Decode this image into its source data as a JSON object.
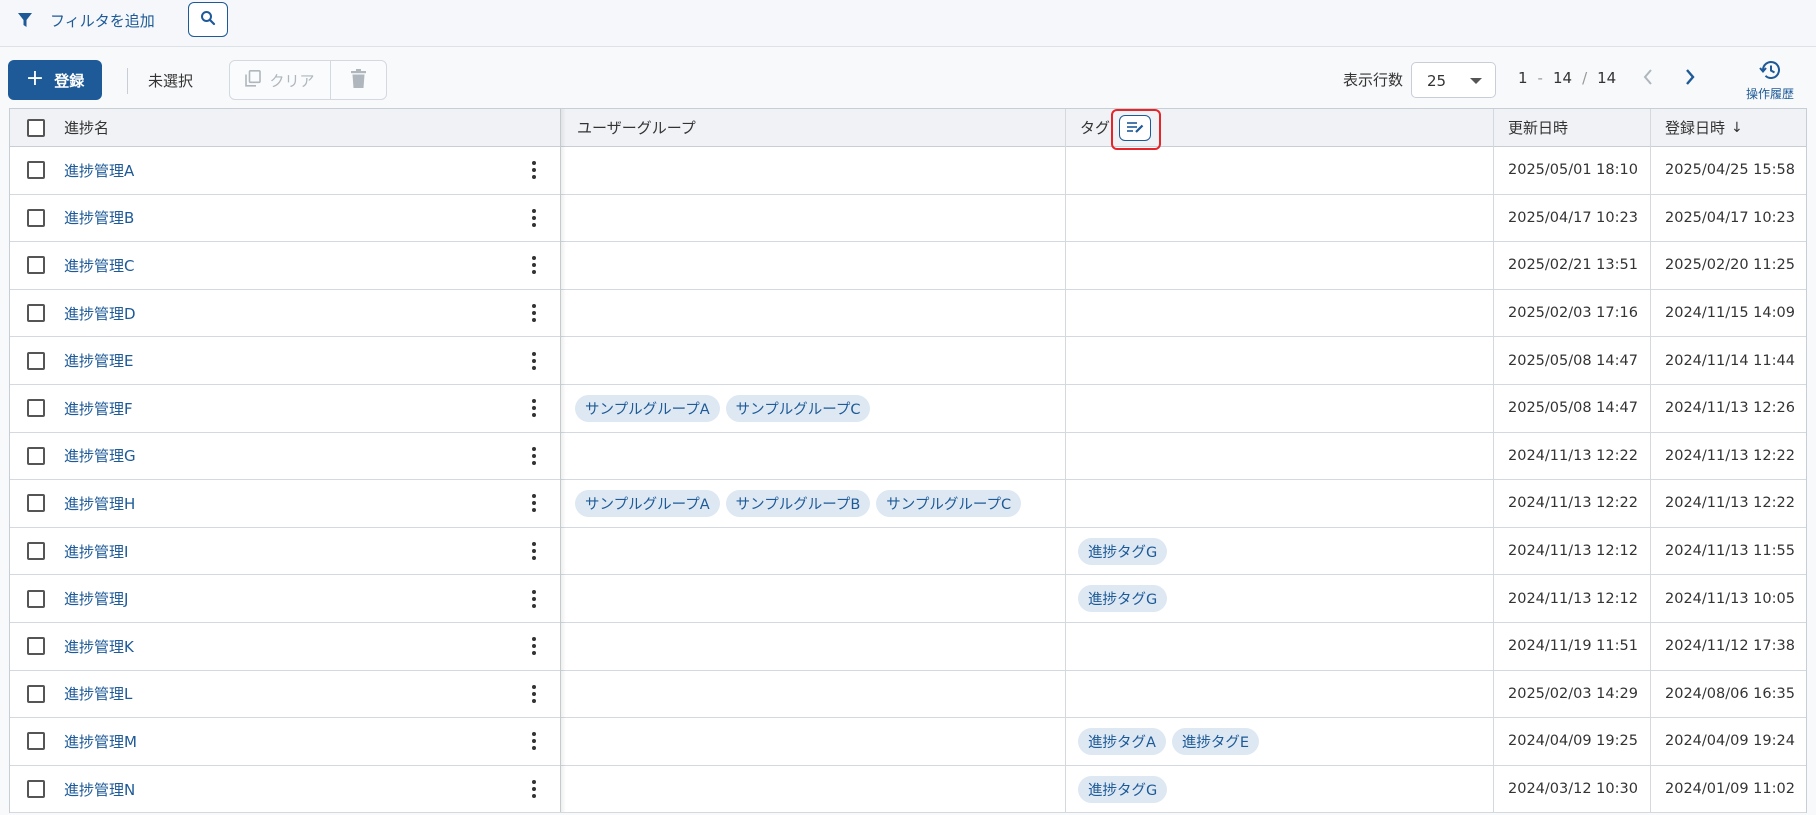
{
  "filterbar": {
    "add_filter_label": "フィルタを追加"
  },
  "toolbar": {
    "register_label": "登録",
    "selection_label": "未選択",
    "clear_label": "クリア",
    "rows_label": "表示行数",
    "rows_value": "25",
    "pager_start": "1",
    "pager_dash": "-",
    "pager_end": "14",
    "pager_slash": "/",
    "pager_total": "14",
    "history_label": "操作履歴"
  },
  "table": {
    "columns": {
      "name": "進捗名",
      "user_group": "ユーザーグループ",
      "tag": "タグ",
      "updated": "更新日時",
      "registered": "登録日時",
      "registered_sort": "↓"
    },
    "rows": [
      {
        "name": "進捗管理A",
        "groups": [],
        "tags": [],
        "updated": "2025/05/01 18:10",
        "registered": "2025/04/25 15:58"
      },
      {
        "name": "進捗管理B",
        "groups": [],
        "tags": [],
        "updated": "2025/04/17 10:23",
        "registered": "2025/04/17 10:23"
      },
      {
        "name": "進捗管理C",
        "groups": [],
        "tags": [],
        "updated": "2025/02/21 13:51",
        "registered": "2025/02/20 11:25"
      },
      {
        "name": "進捗管理D",
        "groups": [],
        "tags": [],
        "updated": "2025/02/03 17:16",
        "registered": "2024/11/15 14:09"
      },
      {
        "name": "進捗管理E",
        "groups": [],
        "tags": [],
        "updated": "2025/05/08 14:47",
        "registered": "2024/11/14 11:44"
      },
      {
        "name": "進捗管理F",
        "groups": [
          "サンプルグループA",
          "サンプルグループC"
        ],
        "tags": [],
        "updated": "2025/05/08 14:47",
        "registered": "2024/11/13 12:26"
      },
      {
        "name": "進捗管理G",
        "groups": [],
        "tags": [],
        "updated": "2024/11/13 12:22",
        "registered": "2024/11/13 12:22"
      },
      {
        "name": "進捗管理H",
        "groups": [
          "サンプルグループA",
          "サンプルグループB",
          "サンプルグループC"
        ],
        "tags": [],
        "updated": "2024/11/13 12:22",
        "registered": "2024/11/13 12:22"
      },
      {
        "name": "進捗管理I",
        "groups": [],
        "tags": [
          "進捗タグG"
        ],
        "updated": "2024/11/13 12:12",
        "registered": "2024/11/13 11:55"
      },
      {
        "name": "進捗管理J",
        "groups": [],
        "tags": [
          "進捗タグG"
        ],
        "updated": "2024/11/13 12:12",
        "registered": "2024/11/13 10:05"
      },
      {
        "name": "進捗管理K",
        "groups": [],
        "tags": [],
        "updated": "2024/11/19 11:51",
        "registered": "2024/11/12 17:38"
      },
      {
        "name": "進捗管理L",
        "groups": [],
        "tags": [],
        "updated": "2025/02/03 14:29",
        "registered": "2024/08/06 16:35"
      },
      {
        "name": "進捗管理M",
        "groups": [],
        "tags": [
          "進捗タグA",
          "進捗タグE"
        ],
        "updated": "2024/04/09 19:25",
        "registered": "2024/04/09 19:24"
      },
      {
        "name": "進捗管理N",
        "groups": [],
        "tags": [
          "進捗タグG"
        ],
        "updated": "2024/03/12 10:30",
        "registered": "2024/01/09 11:02"
      }
    ]
  },
  "colors": {
    "accent": "#1d5a97",
    "chip_bg": "#dde8f3",
    "highlight": "#e5252a"
  },
  "icons": [
    "filter-icon",
    "search-icon",
    "plus-icon",
    "copy-icon",
    "trash-icon",
    "chevron-down-icon",
    "chevron-left-icon",
    "chevron-right-icon",
    "history-icon",
    "kebab-icon",
    "tag-edit-icon"
  ]
}
